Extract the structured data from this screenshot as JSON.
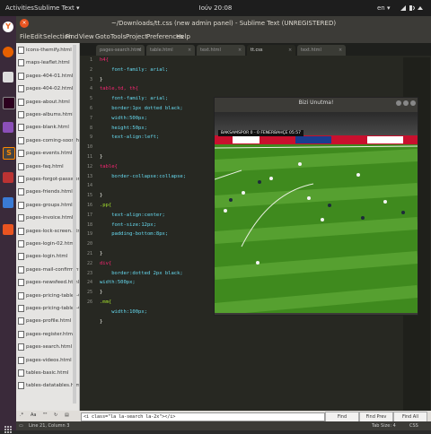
{
  "topbar": {
    "activities": "Activities",
    "app_name": "Sublime Text ▾",
    "clock": "Ιούν 20:08",
    "lang": "en ▾"
  },
  "window": {
    "title": "~/Downloads/tt.css (new admin panel) - Sublime Text (UNREGISTERED)"
  },
  "menu": [
    "File",
    "Edit",
    "Selection",
    "Find",
    "View",
    "Goto",
    "Tools",
    "Project",
    "Preferences",
    "Help"
  ],
  "sidebar": {
    "items": [
      "icons-themify.html",
      "maps-leaflet.html",
      "pages-404-01.html",
      "pages-404-02.html",
      "pages-about.html",
      "pages-albums.html",
      "pages-blank.html",
      "pages-coming-soon.ht",
      "pages-events.html",
      "pages-faq.html",
      "pages-forgot-passwor",
      "pages-friends.html",
      "pages-groups.html",
      "pages-invoice.html",
      "pages-lock-screen.htn",
      "pages-login-02.html",
      "pages-login.html",
      "pages-mail-confirm.ht",
      "pages-newsfeed.html",
      "pages-pricing-tables-C",
      "pages-pricing-tables-C",
      "pages-profile.html",
      "pages-register.html",
      "pages-search.html",
      "pages-videos.html",
      "tables-basic.html",
      "tables-datatables.html"
    ]
  },
  "tabs": [
    {
      "label": "pages-search.html",
      "active": false
    },
    {
      "label": "table.html",
      "active": false
    },
    {
      "label": "text.html",
      "active": false
    },
    {
      "label": "tt.css",
      "active": true
    },
    {
      "label": "text.html",
      "active": false
    }
  ],
  "line_numbers": [
    "1",
    "2",
    "3",
    "4",
    "5",
    "6",
    "7",
    "8",
    "9",
    "10",
    "11",
    "12",
    "13",
    "14",
    "15",
    "16",
    "17",
    "18",
    "19",
    "20",
    "21",
    "22",
    "23",
    "24",
    "25",
    "26"
  ],
  "code_lines": [
    [
      {
        "t": "h4{",
        "c": "#f92672"
      }
    ],
    [
      {
        "t": "    font-family: arial;",
        "c": "#66d9ef"
      }
    ],
    [
      {
        "t": "}",
        "c": "#f8f8f2"
      }
    ],
    [
      {
        "t": "table,td, th{",
        "c": "#f92672"
      }
    ],
    [
      {
        "t": "    font-family: arial;",
        "c": "#66d9ef"
      }
    ],
    [
      {
        "t": "    border:1px dotted black;",
        "c": "#66d9ef"
      }
    ],
    [
      {
        "t": "    width:500px;",
        "c": "#66d9ef"
      }
    ],
    [
      {
        "t": "    height:50px;",
        "c": "#66d9ef"
      }
    ],
    [
      {
        "t": "    text-align:left;",
        "c": "#66d9ef"
      }
    ],
    [
      {
        "t": "",
        "c": "#f8f8f2"
      }
    ],
    [
      {
        "t": "}",
        "c": "#f8f8f2"
      }
    ],
    [
      {
        "t": "table{",
        "c": "#f92672"
      }
    ],
    [
      {
        "t": "    border-collapse:collapse;",
        "c": "#66d9ef"
      }
    ],
    [
      {
        "t": "",
        "c": "#f8f8f2"
      }
    ],
    [
      {
        "t": "}",
        "c": "#f8f8f2"
      }
    ],
    [
      {
        "t": ".pp{",
        "c": "#a6e22e"
      }
    ],
    [
      {
        "t": "    text-align:center;",
        "c": "#66d9ef"
      }
    ],
    [
      {
        "t": "    font-size:12px;",
        "c": "#66d9ef"
      }
    ],
    [
      {
        "t": "    padding-bottom:8px;",
        "c": "#66d9ef"
      }
    ],
    [
      {
        "t": "",
        "c": "#f8f8f2"
      }
    ],
    [
      {
        "t": "}",
        "c": "#f8f8f2"
      }
    ],
    [
      {
        "t": "div{",
        "c": "#f92672"
      }
    ],
    [
      {
        "t": "    border:dotted 2px black;",
        "c": "#66d9ef"
      }
    ],
    [
      {
        "t": "width:500px;",
        "c": "#66d9ef"
      }
    ],
    [
      {
        "t": "}",
        "c": "#f8f8f2"
      }
    ],
    [
      {
        "t": ".mm{",
        "c": "#a6e22e"
      }
    ],
    [
      {
        "t": "    width:100px;",
        "c": "#66d9ef"
      }
    ],
    [
      {
        "t": "}",
        "c": "#f8f8f2"
      }
    ]
  ],
  "findbar": {
    "opt_regex": ".*",
    "opt_case": "Aa",
    "opt_word": "\"\"",
    "query": "<i class=\"la la-search la-2x\"></i>",
    "find": "Find",
    "find_prev": "Find Prev",
    "find_all": "Find All"
  },
  "statusbar": {
    "position": "Line 21, Column 3",
    "tab_size": "Tab Size: 4",
    "syntax": "CSS"
  },
  "video_window": {
    "title": "Bizi Unutma!",
    "score": "BAKSAMSPOR  0 - 0  FENERBAHÇE   05:57"
  },
  "colors": {
    "accent": "#e95420",
    "pitch": "#3f8a1e"
  }
}
